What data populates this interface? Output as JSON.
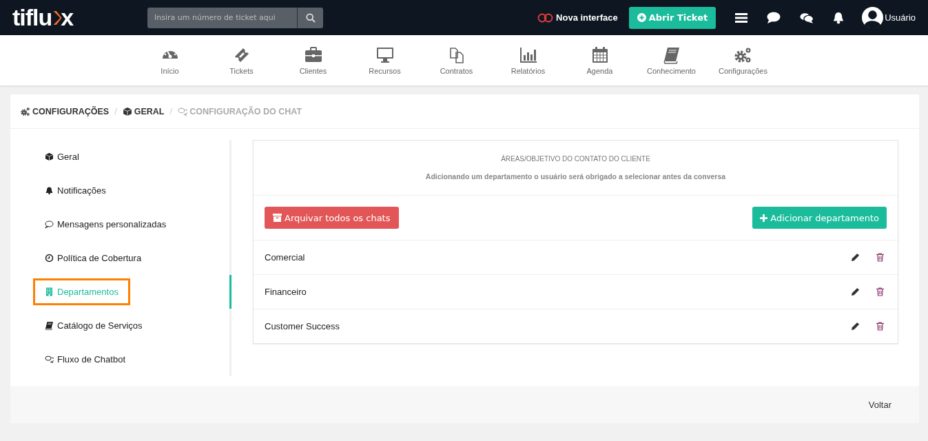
{
  "header": {
    "logo_text": "tiflu",
    "logo_end": "x",
    "search": {
      "placeholder": "Insira um número de ticket aqui"
    },
    "new_interface": {
      "label": "Nova interface",
      "on": false
    },
    "open_ticket": "Abrir Ticket",
    "user": "Usuário"
  },
  "nav": [
    {
      "label": "Início",
      "kind": "gauge"
    },
    {
      "label": "Tickets",
      "kind": "ticket"
    },
    {
      "label": "Clientes",
      "kind": "briefcase"
    },
    {
      "label": "Recursos",
      "kind": "monitor"
    },
    {
      "label": "Contratos",
      "kind": "files"
    },
    {
      "label": "Relatórios",
      "kind": "chart"
    },
    {
      "label": "Agenda",
      "kind": "calendar"
    },
    {
      "label": "Conhecimento",
      "kind": "book"
    },
    {
      "label": "Configurações",
      "kind": "gears"
    }
  ],
  "breadcrumb": [
    {
      "label": "CONFIGURAÇÕES",
      "kind": "gears",
      "current": false
    },
    {
      "separator": "/",
      "label": "GERAL",
      "kind": "cube",
      "current": false
    },
    {
      "separator": "/",
      "label": "CONFIGURAÇÃO DO CHAT",
      "kind": "chats",
      "current": true
    }
  ],
  "sidebar": {
    "items": [
      {
        "label": "Geral",
        "kind": "cube",
        "selected": false,
        "highlighted": false
      },
      {
        "label": "Notificações",
        "kind": "bell",
        "selected": false,
        "highlighted": false
      },
      {
        "label": "Mensagens personalizadas",
        "kind": "bubble",
        "selected": false,
        "highlighted": false
      },
      {
        "label": "Política de Cobertura",
        "kind": "clock",
        "selected": false,
        "highlighted": false
      },
      {
        "label": "Departamentos",
        "kind": "building",
        "selected": true,
        "highlighted": true
      },
      {
        "label": "Catálogo de Serviços",
        "kind": "book",
        "selected": false,
        "highlighted": false
      },
      {
        "label": "Fluxo de Chatbot",
        "kind": "chats",
        "selected": false,
        "highlighted": false
      }
    ]
  },
  "panel": {
    "title": "ÁREAS/OBJETIVO DO CONTATO DO CLIENTE",
    "description": "Adicionando um departamento o usuário será obrigado a selecionar antes da conversa",
    "archive_button": "Arquivar todos os chats",
    "add_button": "Adicionar departamento",
    "departments": [
      "Comercial",
      "Financeiro",
      "Customer Success"
    ]
  },
  "footer": {
    "back": "Voltar"
  }
}
